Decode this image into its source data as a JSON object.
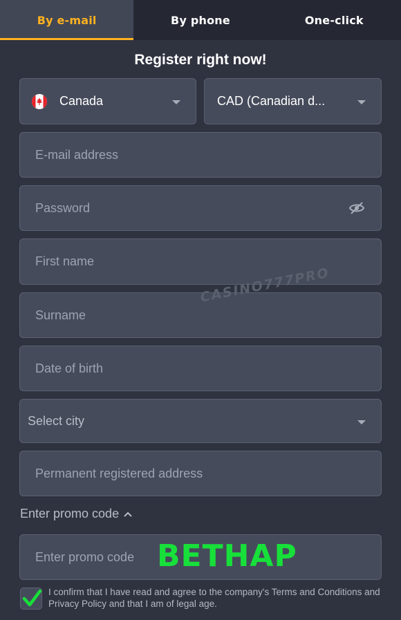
{
  "tabs": [
    {
      "label": "By e-mail",
      "active": true
    },
    {
      "label": "By phone",
      "active": false
    },
    {
      "label": "One-click",
      "active": false
    }
  ],
  "form": {
    "title": "Register right now!",
    "country": {
      "value": "Canada",
      "flag": "canada-flag-icon"
    },
    "currency": {
      "value": "CAD (Canadian d..."
    },
    "email": {
      "placeholder": "E-mail address"
    },
    "password": {
      "placeholder": "Password",
      "icon": "eye-slash-icon"
    },
    "first_name": {
      "placeholder": "First name"
    },
    "surname": {
      "placeholder": "Surname"
    },
    "date_of_birth": {
      "placeholder": "Date of birth"
    },
    "city": {
      "value": "Select city"
    },
    "address": {
      "placeholder": "Permanent registered address"
    },
    "promo_toggle": {
      "label": "Enter promo code",
      "icon": "chevron-up-icon"
    },
    "promo": {
      "placeholder": "Enter promo code",
      "overlay_code": "BETHAP"
    },
    "terms": {
      "checked": true,
      "text": "I confirm that I have read and agree to the company's Terms and Conditions and Privacy Policy and that I am of legal age."
    }
  },
  "watermark": "CASINO777PRO",
  "colors": {
    "background": "#2f3340",
    "field": "#464b5b",
    "accent": "#ffb21e",
    "promo_overlay": "#18e03a",
    "check": "#18e03a"
  }
}
